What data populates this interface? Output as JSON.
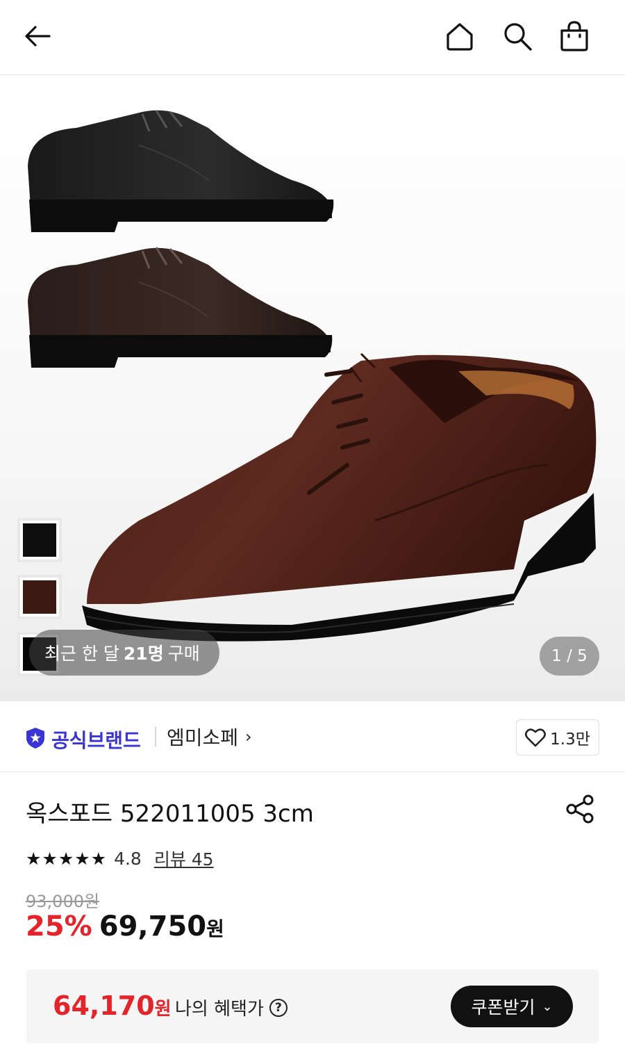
{
  "header": {
    "back_icon": "arrow-left-icon",
    "home_icon": "home-icon",
    "search_icon": "search-icon",
    "cart_icon": "shopping-bag-icon"
  },
  "gallery": {
    "color_swatches": [
      "black",
      "brown",
      "black"
    ],
    "recent_prefix": "최근 한 달",
    "recent_count": "21명",
    "recent_suffix": "구매",
    "pager": "1 / 5"
  },
  "brand": {
    "badge_icon": "star-shield-icon",
    "official_label": "공식브랜드",
    "name": "엠미소페",
    "chevron": "›",
    "like_count": "1.3만"
  },
  "product": {
    "title": "옥스포드 522011005 3cm",
    "stars": "★★★★★",
    "rating": "4.8",
    "review_label": "리뷰 45",
    "original_price": "93,000원",
    "discount": "25%",
    "price": "69,750",
    "currency": "원"
  },
  "benefit": {
    "price": "64,170",
    "currency": "원",
    "label": "나의 혜택가",
    "help": "?",
    "coupon_button": "쿠폰받기",
    "coupon_chevron": "⌄"
  },
  "colors": {
    "accent_red": "#e3242b",
    "brand_blue": "#3b34d4"
  }
}
